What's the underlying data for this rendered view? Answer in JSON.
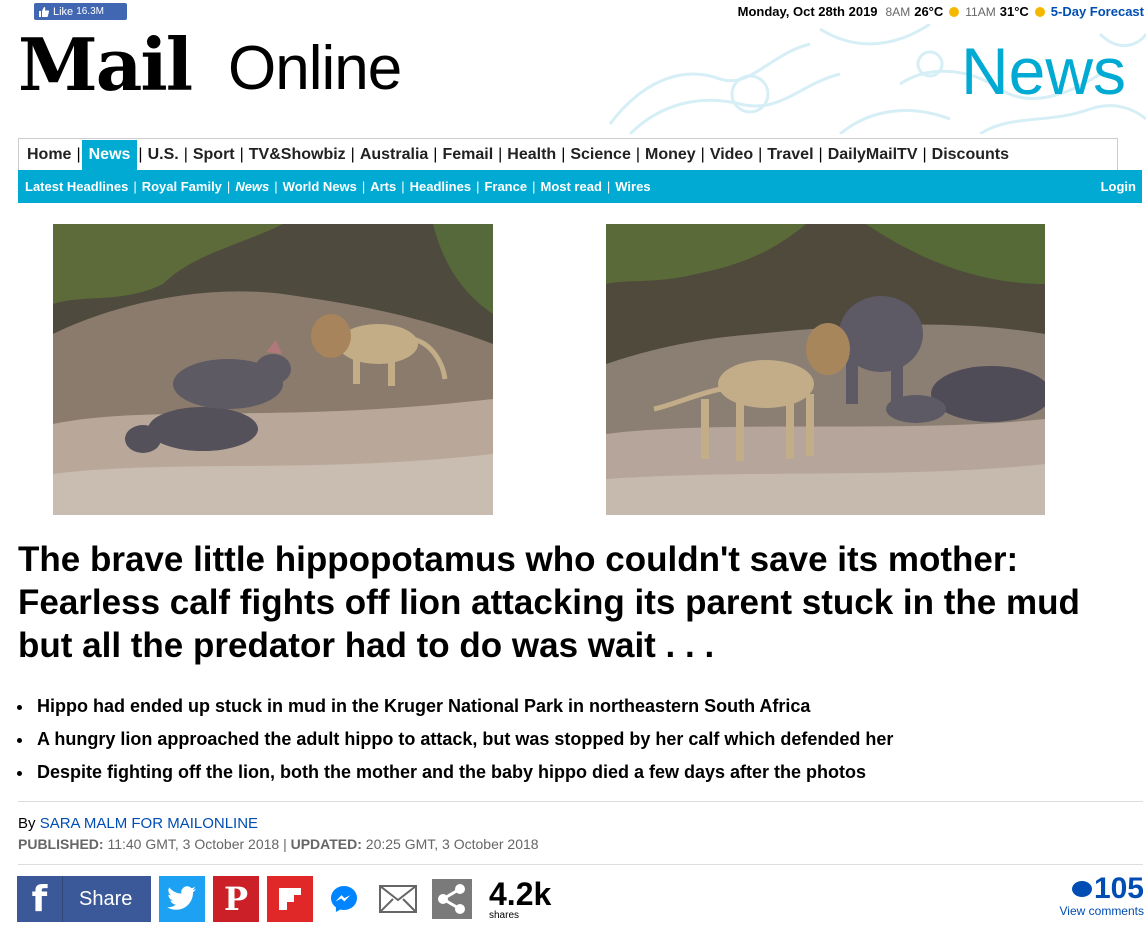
{
  "topbar": {
    "like_label": "Like",
    "like_count": "16.3M",
    "date": "Monday, Oct 28th 2019",
    "time1": "8AM",
    "temp1": "26°C",
    "time2": "11AM",
    "temp2": "31°C",
    "forecast_link": "5-Day Forecast"
  },
  "masthead": {
    "logo_mail": "Mail",
    "logo_online": "Online",
    "channel": "News"
  },
  "nav": {
    "primary": [
      "Home",
      "News",
      "U.S.",
      "Sport",
      "TV&Showbiz",
      "Australia",
      "Femail",
      "Health",
      "Science",
      "Money",
      "Video",
      "Travel",
      "DailyMailTV",
      "Discounts"
    ],
    "primary_active": "News",
    "secondary": [
      "Latest Headlines",
      "Royal Family",
      "News",
      "World News",
      "Arts",
      "Headlines",
      "France",
      "Most read",
      "Wires"
    ],
    "login": "Login"
  },
  "article": {
    "headline": "The brave little hippopotamus who couldn't save its mother: Fearless calf fights off lion attacking its parent stuck in the mud but all the predator had to do was wait . . .",
    "bullets": [
      "Hippo had ended up stuck in mud in the Kruger National Park in northeastern South Africa",
      "A hungry lion approached the adult hippo to attack, but was stopped by her calf which defended her",
      "Despite fighting off the lion, both the mother and the baby hippo died a few days after the photos"
    ],
    "byline_prefix": "By",
    "author": "SARA MALM FOR MAILONLINE",
    "published_label": "PUBLISHED:",
    "published": "11:40 GMT, 3 October 2018",
    "updated_label": "UPDATED:",
    "updated": "20:25 GMT, 3 October 2018"
  },
  "share": {
    "fb_label": "Share",
    "count": "4.2k",
    "count_label": "shares",
    "comments_count": "105",
    "comments_label": "View comments"
  },
  "colors": {
    "accent": "#00aad2",
    "link": "#004db3",
    "facebook": "#3b5998",
    "twitter": "#1da1f2",
    "pinterest": "#cb2027",
    "flipboard": "#e12828"
  }
}
